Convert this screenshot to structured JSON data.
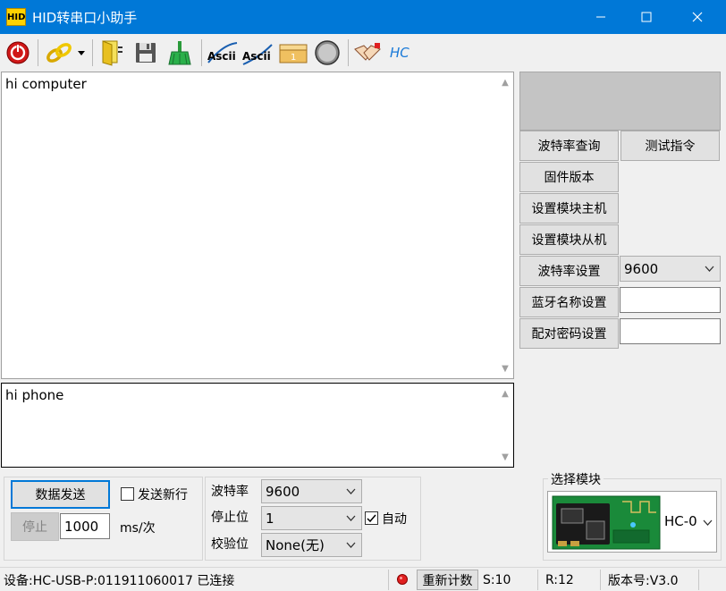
{
  "window": {
    "app_icon_text": "HID",
    "title": "HID转串口小助手"
  },
  "toolbar": {
    "icons": [
      "power-icon",
      "link-icon",
      "dropdown-arrow-icon",
      "open-file-icon",
      "save-icon",
      "clear-broom-icon",
      "ascii-send-icon",
      "ascii-receive-icon",
      "counter-folder-icon",
      "circle-icon",
      "handshake-icon",
      "hc-logo-icon"
    ],
    "ascii1": "Ascii",
    "ascii2": "Ascii",
    "folder_badge": "1",
    "hc_text": "HC"
  },
  "receive_area": {
    "text": "hi computer"
  },
  "send_area": {
    "text": "hi phone"
  },
  "side_panel": {
    "baud_query": "波特率查询",
    "test_cmd": "测试指令",
    "firmware": "固件版本",
    "set_master": "设置模块主机",
    "set_slave": "设置模块从机",
    "baud_set": "波特率设置",
    "baud_set_value": "9600",
    "bt_name_set": "蓝牙名称设置",
    "bt_name_value": "",
    "pair_pwd_set": "配对密码设置",
    "pair_pwd_value": ""
  },
  "send_controls": {
    "send_button": "数据发送",
    "newline_label": "发送新行",
    "stop_button": "停止",
    "interval_value": "1000",
    "interval_unit": "ms/次"
  },
  "serial_settings": {
    "baud_label": "波特率",
    "baud_value": "9600",
    "stop_label": "停止位",
    "stop_value": "1",
    "auto_label": "自动",
    "parity_label": "校验位",
    "parity_value": "None(无)"
  },
  "module_select": {
    "title": "选择模块",
    "value": "HC-0"
  },
  "status_bar": {
    "device": "设备:HC-USB-P:011911060017 已连接",
    "reset_count": "重新计数",
    "sent": "S:10",
    "received": "R:12",
    "version": "版本号:V3.0"
  },
  "colors": {
    "titlebar": "#0078d7",
    "status_led": "#e02020",
    "focus": "#0078d7"
  }
}
